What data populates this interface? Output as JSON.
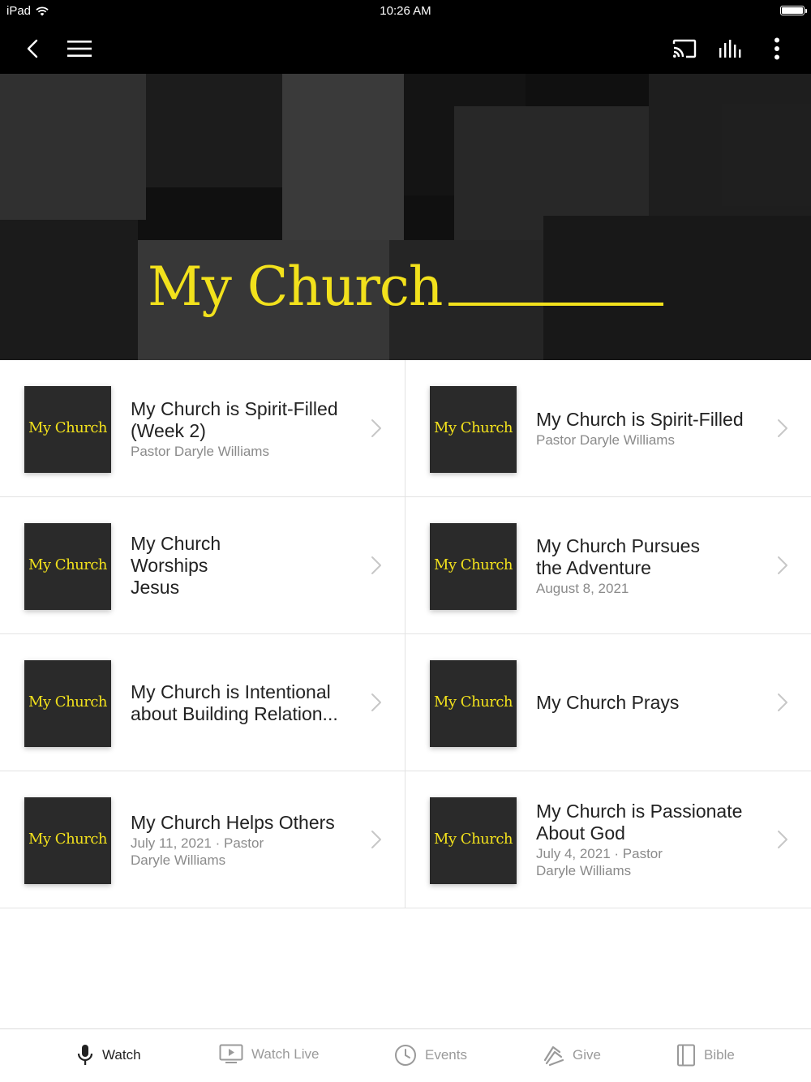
{
  "status_bar": {
    "device": "iPad",
    "time": "10:26 AM"
  },
  "hero": {
    "title": "My Church"
  },
  "thumbnail_text": "My Church",
  "items": [
    {
      "title": "My Church is Spirit-Filled (Week 2)",
      "subtitle": "Pastor Daryle Williams"
    },
    {
      "title": "My Church is Spirit-Filled",
      "subtitle": "Pastor Daryle Williams"
    },
    {
      "title": "My Church Worships Jesus",
      "subtitle": ""
    },
    {
      "title": "My Church Pursues the Adventure",
      "subtitle": "August 8, 2021"
    },
    {
      "title": "My Church is Intentional about Building Relation...",
      "subtitle": ""
    },
    {
      "title": "My Church Prays",
      "subtitle": ""
    },
    {
      "title": "My Church Helps Others",
      "subtitle": "July 11, 2021 · Pastor Daryle Williams"
    },
    {
      "title": "My Church is Passionate About God",
      "subtitle": "July 4, 2021 · Pastor Daryle Williams"
    }
  ],
  "tabs": [
    {
      "label": "Watch",
      "icon": "microphone-icon",
      "active": true
    },
    {
      "label": "Watch Live",
      "icon": "tv-play-icon",
      "active": false
    },
    {
      "label": "Events",
      "icon": "clock-icon",
      "active": false
    },
    {
      "label": "Give",
      "icon": "give-icon",
      "active": false
    },
    {
      "label": "Bible",
      "icon": "book-icon",
      "active": false
    }
  ],
  "colors": {
    "accent_yellow": "#f2e11c",
    "bar_black": "#000000",
    "divider": "#e3e3e3",
    "muted_text": "#8a8a8a"
  }
}
